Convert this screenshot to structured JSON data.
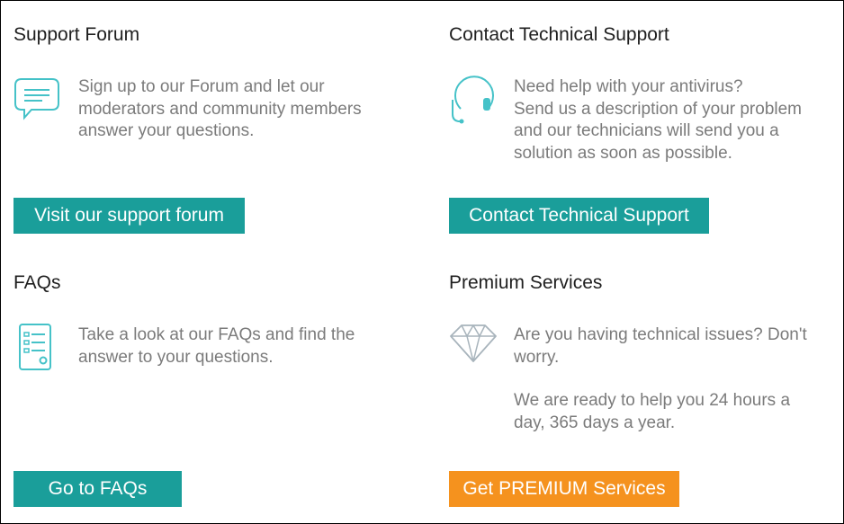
{
  "support_forum": {
    "title": "Support Forum",
    "icon": "chat-bubble-icon",
    "description": [
      "Sign up to our Forum and let our",
      "moderators and community members",
      "answer your questions."
    ],
    "button_label": "Visit our support forum"
  },
  "technical_support": {
    "title": "Contact Technical Support",
    "icon": "headset-icon",
    "description": [
      "Need help with your antivirus?",
      "Send us a description of your problem",
      "and our technicians will send you a",
      "solution as soon as possible."
    ],
    "button_label": "Contact Technical Support"
  },
  "faqs": {
    "title": "FAQs",
    "icon": "faq-list-icon",
    "description": [
      "Take a look at our FAQs and find the",
      "answer to your questions."
    ],
    "button_label": "Go to FAQs"
  },
  "premium": {
    "title": "Premium Services",
    "icon": "diamond-icon",
    "description": [
      "Are you having technical issues? Don't",
      "worry."
    ],
    "description2": [
      "We are ready to help you 24 hours a",
      "day, 365 days a year."
    ],
    "button_label": "Get PREMIUM Services"
  },
  "colors": {
    "teal": "#1a9e9a",
    "orange": "#f5921e",
    "icon": "#45c2c8",
    "diamond": "#a8b4bc"
  }
}
